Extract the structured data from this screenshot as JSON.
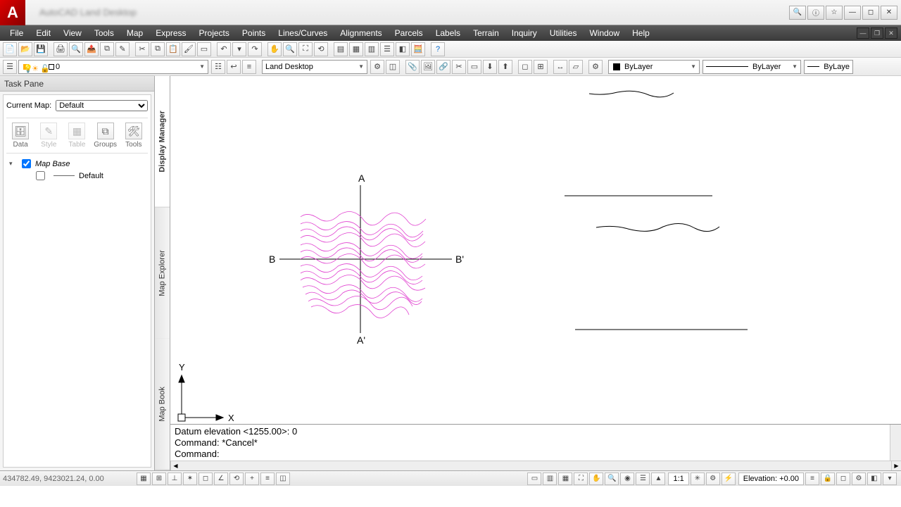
{
  "title": "AutoCAD Land Desktop",
  "menus": [
    "File",
    "Edit",
    "View",
    "Tools",
    "Map",
    "Express",
    "Projects",
    "Points",
    "Lines/Curves",
    "Alignments",
    "Parcels",
    "Labels",
    "Terrain",
    "Inquiry",
    "Utilities",
    "Window",
    "Help"
  ],
  "layer_dropdown": {
    "value": "0"
  },
  "workspace_dropdown": {
    "value": "Land Desktop"
  },
  "color_dropdown": {
    "value": "ByLayer"
  },
  "linetype_dropdown": {
    "value": "ByLayer"
  },
  "lineweight_dropdown": {
    "value": "ByLaye"
  },
  "task_pane": {
    "title": "Task Pane",
    "current_map_label": "Current Map:",
    "current_map_value": "Default",
    "icons": [
      {
        "label": "Data",
        "glyph": "🗄"
      },
      {
        "label": "Style",
        "glyph": "✎"
      },
      {
        "label": "Table",
        "glyph": "▦"
      },
      {
        "label": "Groups",
        "glyph": "⧉"
      },
      {
        "label": "Tools",
        "glyph": "🛠"
      }
    ],
    "tree": {
      "root": "Map Base",
      "child": "Default",
      "root_checked": true,
      "child_checked": false
    }
  },
  "side_tabs": [
    "Display Manager",
    "Map Explorer",
    "Map Book"
  ],
  "drawing_labels": {
    "A": "A",
    "Ap": "A'",
    "B": "B",
    "Bp": "B'",
    "X": "X",
    "Y": "Y"
  },
  "command_lines": [
    "Datum elevation <1255.00>: 0",
    "Command: *Cancel*",
    "Command:"
  ],
  "status": {
    "coords": "434782.49, 9423021.24, 0.00",
    "scale": "1:1",
    "elevation_label": "Elevation:",
    "elevation_value": "+0.00"
  }
}
